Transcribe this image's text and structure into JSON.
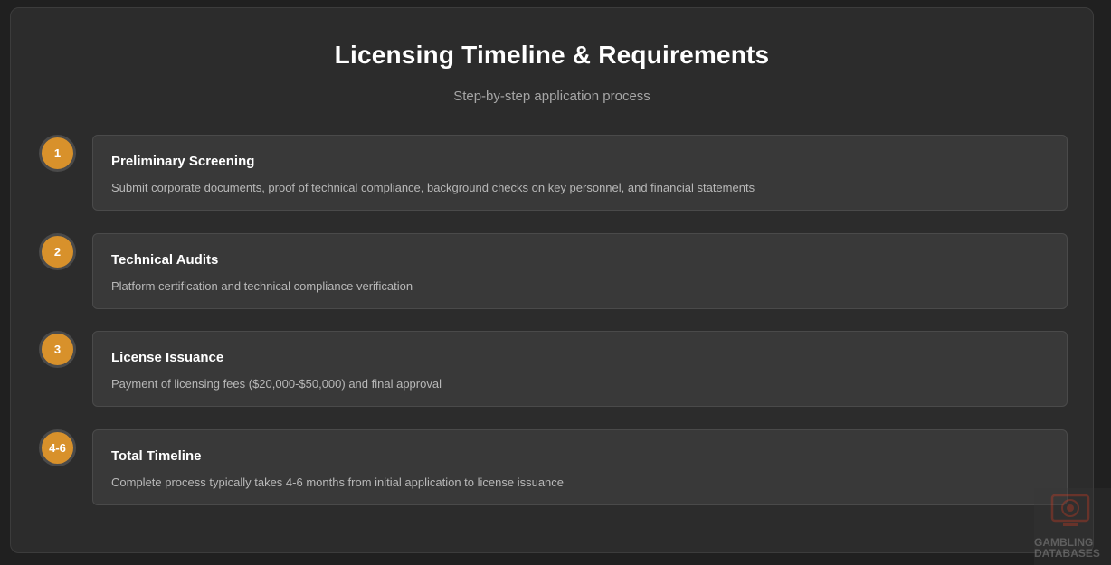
{
  "header": {
    "title": "Licensing Timeline & Requirements",
    "subtitle": "Step-by-step application process"
  },
  "steps": [
    {
      "badge": "1",
      "title": "Preliminary Screening",
      "description": "Submit corporate documents, proof of technical compliance, background checks on key personnel, and financial statements"
    },
    {
      "badge": "2",
      "title": "Technical Audits",
      "description": "Platform certification and technical compliance verification"
    },
    {
      "badge": "3",
      "title": "License Issuance",
      "description": "Payment of licensing fees ($20,000-$50,000) and final approval"
    },
    {
      "badge": "4-6",
      "title": "Total Timeline",
      "description": "Complete process typically takes 4-6 months from initial application to license issuance"
    }
  ],
  "watermark": {
    "line1": "GAMBLING",
    "line2": "DATABASES",
    "icon": "monitor-poker-chip-icon"
  },
  "colors": {
    "accent": "#d8912b",
    "background": "#202020",
    "card": "#2c2c2c",
    "step_box": "#393939"
  }
}
